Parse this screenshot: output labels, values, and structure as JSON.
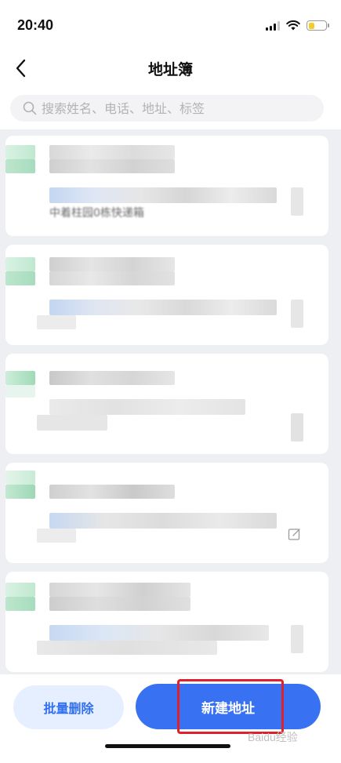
{
  "status_bar": {
    "time": "20:40",
    "icons": [
      "cellular-signal-icon",
      "wifi-icon",
      "battery-icon"
    ],
    "battery_level": 0.35,
    "battery_color": "#f5cb2b"
  },
  "nav": {
    "back_icon": "chevron-left-icon",
    "title": "地址簿"
  },
  "search": {
    "icon": "search-icon",
    "placeholder": "搜索姓名、电话、地址、标签"
  },
  "address_list": {
    "items": [
      {
        "name": "",
        "address": "中着柱园0栋快递箱"
      },
      {
        "name": "",
        "address": ""
      },
      {
        "name": "",
        "address": ""
      },
      {
        "name": "",
        "address": ""
      },
      {
        "name": "",
        "address": ""
      }
    ],
    "edit_icon": "edit-icon"
  },
  "bottom_bar": {
    "batch_delete_label": "批量删除",
    "new_address_label": "新建地址",
    "watermark": "Baidu经验"
  },
  "colors": {
    "primary": "#3872f2",
    "primary_light": "#e6efff",
    "highlight": "#e0202a",
    "list_bg": "#eeeff3"
  }
}
